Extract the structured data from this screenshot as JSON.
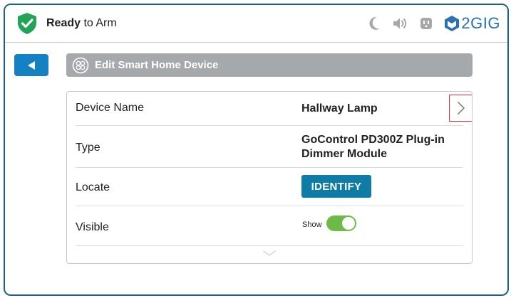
{
  "header": {
    "status_bold": "Ready",
    "status_rest": " to Arm",
    "brand": "2GIG",
    "icons": [
      "shield-check-icon",
      "moon-icon",
      "speaker-icon",
      "outlet-icon",
      "brand-cube-icon"
    ],
    "colors": {
      "shield": "#22a456",
      "accent": "#1580c2",
      "brand": "#2a6fb0"
    }
  },
  "nav": {
    "back_icon": "triangle-left-icon",
    "title": "Edit Smart Home Device",
    "title_icon": "smart-home-device-icon"
  },
  "device": {
    "rows": [
      {
        "label": "Device Name",
        "value": "Hallway Lamp"
      },
      {
        "label": "Type",
        "value_line1": "GoControl PD300Z Plug-in",
        "value_line2": "Dimmer Module"
      },
      {
        "label": "Locate",
        "button": "IDENTIFY"
      },
      {
        "label": "Visible",
        "toggle_label": "Show",
        "toggle_on": true
      }
    ],
    "colors": {
      "identify_button": "#0f7ca6",
      "toggle_on": "#6dbb46",
      "highlight": "#d9312f"
    }
  }
}
